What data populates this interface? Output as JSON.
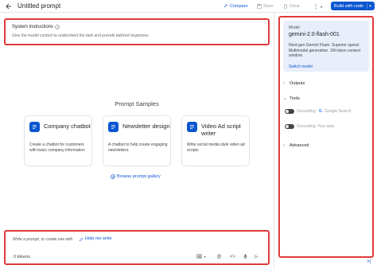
{
  "header": {
    "title": "Untitled prompt",
    "compare": "Compare",
    "save": "Save",
    "clear": "Clear",
    "build": "Build with code"
  },
  "system": {
    "title": "System instructions",
    "placeholder": "Give the model context to understand the task and provide tailored responses"
  },
  "samples": {
    "title": "Prompt Samples",
    "cards": [
      {
        "title": "Company chatbot",
        "desc": "Create a chatbot for customers with basic company information"
      },
      {
        "title": "Newsletter design",
        "desc": "A chatbot to help create engaging newsletters."
      },
      {
        "title": "Video Ad script writer",
        "desc": "Write social media style video ad scripts"
      }
    ],
    "gallery": "Browse prompt gallery"
  },
  "prompt": {
    "placeholder": "Write a prompt, or create one with",
    "help": "Help me write",
    "tokens": "0 tokens"
  },
  "panel": {
    "model_label": "Model",
    "model_name": "gemini-2.0-flash-001",
    "model_desc": "Next-gen Gemini Flash. Superior speed. Multimodal generation. 1M token context window.",
    "switch": "Switch model",
    "outputs": "Outputs",
    "tools": "Tools",
    "grounding_search": "Grounding:",
    "google_search": "Google Search",
    "grounding_data": "Grounding: Your data",
    "advanced": "Advanced"
  },
  "colors": {
    "accent": "#0b57d0",
    "highlight": "#e33a3a",
    "model_card_bg": "#e8eefa"
  }
}
